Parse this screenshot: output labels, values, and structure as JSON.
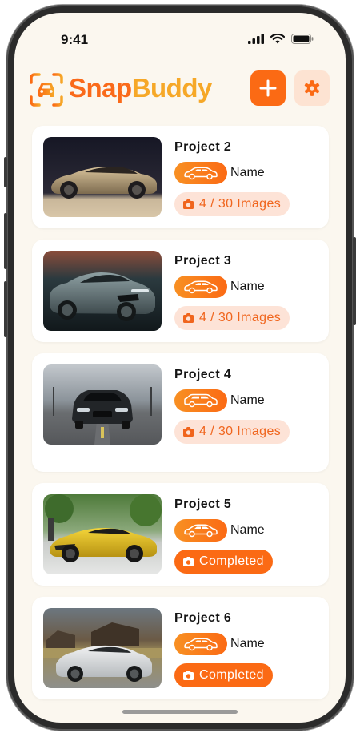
{
  "status_bar": {
    "time": "9:41"
  },
  "app": {
    "name_part1": "Snap",
    "name_part2": "Buddy",
    "brand_color": "#fb6a14",
    "accent_color": "#f6a828"
  },
  "toolbar": {
    "add_icon": "plus-icon",
    "settings_icon": "gear-icon"
  },
  "projects": [
    {
      "title": "Project 2",
      "name_label": "Name",
      "status_text": "4 / 30 Images",
      "status": "in-progress",
      "image": "bronze sedan"
    },
    {
      "title": "Project 3",
      "name_label": "Name",
      "status_text": "4 / 30 Images",
      "status": "in-progress",
      "image": "grey coupe"
    },
    {
      "title": "Project 4",
      "name_label": "Name",
      "status_text": "4 / 30 Images",
      "status": "in-progress",
      "image": "black muscle car"
    },
    {
      "title": "Project 5",
      "name_label": "Name",
      "status_text": "Completed",
      "status": "completed",
      "image": "yellow supercar"
    },
    {
      "title": "Project 6",
      "name_label": "Name",
      "status_text": "Completed",
      "status": "completed",
      "image": "white supercar"
    }
  ]
}
